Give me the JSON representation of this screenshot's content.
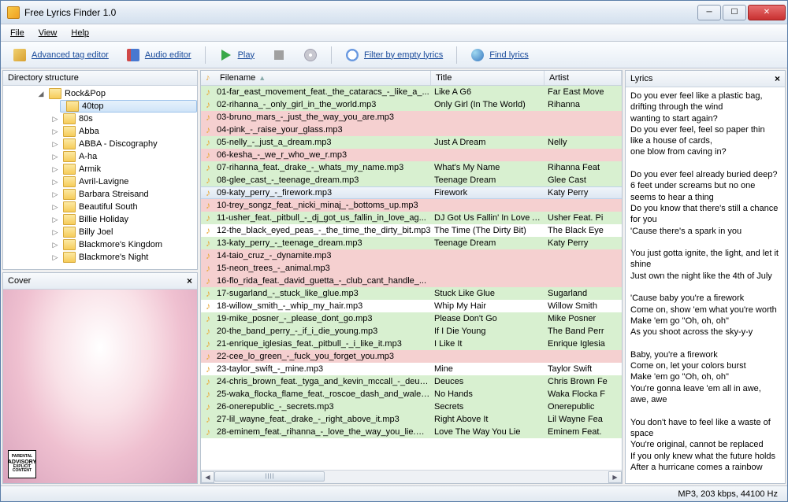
{
  "window_title": "Free Lyrics Finder 1.0",
  "menubar": [
    "File",
    "View",
    "Help"
  ],
  "toolbar": {
    "advanced_tag": "Advanced tag editor",
    "audio_editor": "Audio editor",
    "play": "Play",
    "filter": "Filter by empty lyrics",
    "find": "Find lyrics"
  },
  "panels": {
    "directory": "Directory structure",
    "cover": "Cover",
    "lyrics": "Lyrics"
  },
  "tree": {
    "root": "Rock&Pop",
    "selected": "40top",
    "items": [
      "80s",
      "Abba",
      "ABBA - Discography",
      "A-ha",
      "Armik",
      "Avril-Lavigne",
      "Barbara Streisand",
      "Beautiful South",
      "Billie Holiday",
      "Billy Joel",
      "Blackmore's Kingdom",
      "Blackmore's Night"
    ]
  },
  "columns": {
    "filename": "Filename",
    "title": "Title",
    "artist": "Artist"
  },
  "rows": [
    {
      "f": "01-far_east_movement_feat._the_cataracs_-_like_a_...",
      "t": "Like A G6",
      "a": "Far East Move",
      "c": "green"
    },
    {
      "f": "02-rihanna_-_only_girl_in_the_world.mp3",
      "t": "Only Girl (In The World)",
      "a": "Rihanna",
      "c": "green"
    },
    {
      "f": "03-bruno_mars_-_just_the_way_you_are.mp3",
      "t": "",
      "a": "",
      "c": "red"
    },
    {
      "f": "04-pink_-_raise_your_glass.mp3",
      "t": "",
      "a": "",
      "c": "red"
    },
    {
      "f": "05-nelly_-_just_a_dream.mp3",
      "t": "Just A Dream",
      "a": "Nelly",
      "c": "green"
    },
    {
      "f": "06-kesha_-_we_r_who_we_r.mp3",
      "t": "",
      "a": "",
      "c": "red"
    },
    {
      "f": "07-rihanna_feat._drake_-_whats_my_name.mp3",
      "t": "What's My Name",
      "a": "Rihanna Feat",
      "c": "green"
    },
    {
      "f": "08-glee_cast_-_teenage_dream.mp3",
      "t": "Teenage Dream",
      "a": "Glee Cast",
      "c": "green"
    },
    {
      "f": "09-katy_perry_-_firework.mp3",
      "t": "Firework",
      "a": "Katy Perry",
      "c": "selected"
    },
    {
      "f": "10-trey_songz_feat._nicki_minaj_-_bottoms_up.mp3",
      "t": "",
      "a": "",
      "c": "red"
    },
    {
      "f": "11-usher_feat._pitbull_-_dj_got_us_fallin_in_love_ag...",
      "t": "DJ Got Us Fallin' In Love A...",
      "a": "Usher Feat. Pi",
      "c": "green"
    },
    {
      "f": "12-the_black_eyed_peas_-_the_time_the_dirty_bit.mp3",
      "t": "The Time (The Dirty Bit)",
      "a": "The Black Eye",
      "c": ""
    },
    {
      "f": "13-katy_perry_-_teenage_dream.mp3",
      "t": "Teenage Dream",
      "a": "Katy Perry",
      "c": "green"
    },
    {
      "f": "14-taio_cruz_-_dynamite.mp3",
      "t": "",
      "a": "",
      "c": "red"
    },
    {
      "f": "15-neon_trees_-_animal.mp3",
      "t": "",
      "a": "",
      "c": "red"
    },
    {
      "f": "16-flo_rida_feat._david_guetta_-_club_cant_handle_...",
      "t": "",
      "a": "",
      "c": "red"
    },
    {
      "f": "17-sugarland_-_stuck_like_glue.mp3",
      "t": "Stuck Like Glue",
      "a": "Sugarland",
      "c": "green"
    },
    {
      "f": "18-willow_smith_-_whip_my_hair.mp3",
      "t": "Whip My Hair",
      "a": "Willow Smith",
      "c": ""
    },
    {
      "f": "19-mike_posner_-_please_dont_go.mp3",
      "t": "Please Don't Go",
      "a": "Mike Posner",
      "c": "green"
    },
    {
      "f": "20-the_band_perry_-_if_i_die_young.mp3",
      "t": "If I Die Young",
      "a": "The Band Perr",
      "c": "green"
    },
    {
      "f": "21-enrique_iglesias_feat._pitbull_-_i_like_it.mp3",
      "t": "I Like It",
      "a": "Enrique Iglesia",
      "c": "green"
    },
    {
      "f": "22-cee_lo_green_-_fuck_you_forget_you.mp3",
      "t": "",
      "a": "",
      "c": "red"
    },
    {
      "f": "23-taylor_swift_-_mine.mp3",
      "t": "Mine",
      "a": "Taylor Swift",
      "c": ""
    },
    {
      "f": "24-chris_brown_feat._tyga_and_kevin_mccall_-_deuc...",
      "t": "Deuces",
      "a": "Chris Brown Fe",
      "c": "green"
    },
    {
      "f": "25-waka_flocka_flame_feat._roscoe_dash_and_wale_...",
      "t": "No Hands",
      "a": "Waka Flocka F",
      "c": "green"
    },
    {
      "f": "26-onerepublic_-_secrets.mp3",
      "t": "Secrets",
      "a": "Onerepublic",
      "c": "green"
    },
    {
      "f": "27-lil_wayne_feat._drake_-_right_above_it.mp3",
      "t": "Right Above It",
      "a": "Lil Wayne Fea",
      "c": "green"
    },
    {
      "f": "28-eminem_feat._rihanna_-_love_the_way_you_lie.mp3",
      "t": "Love The Way You Lie",
      "a": "Eminem Feat.",
      "c": "green"
    }
  ],
  "lyrics_text": "Do you ever feel like a plastic bag,\ndrifting through the wind\nwanting to start again?\nDo you ever feel, feel so paper thin\nlike a house of cards,\none blow from caving in?\n\nDo you ever feel already buried deep?\n6 feet under screams but no one seems to hear a thing\nDo you know that there's still a chance for you\n'Cause there's a spark in you\n\nYou just gotta ignite, the light, and let it shine\nJust own the night like the 4th of July\n\n'Cause baby you're a firework\nCome on, show 'em what you're worth\nMake 'em go \"Oh, oh, oh\"\nAs you shoot across the sky-y-y\n\nBaby, you're a firework\nCome on, let your colors burst\nMake 'em go \"Oh, oh, oh\"\nYou're gonna leave 'em all in awe, awe, awe\n\nYou don't have to feel like a waste of space\nYou're original, cannot be replaced\nIf you only knew what the future holds\nAfter a hurricane comes a rainbow",
  "status": "MP3, 203 kbps, 44100 Hz",
  "advisory": {
    "line1": "PARENTAL",
    "line2": "ADVISORY",
    "line3": "EXPLICIT CONTENT"
  }
}
